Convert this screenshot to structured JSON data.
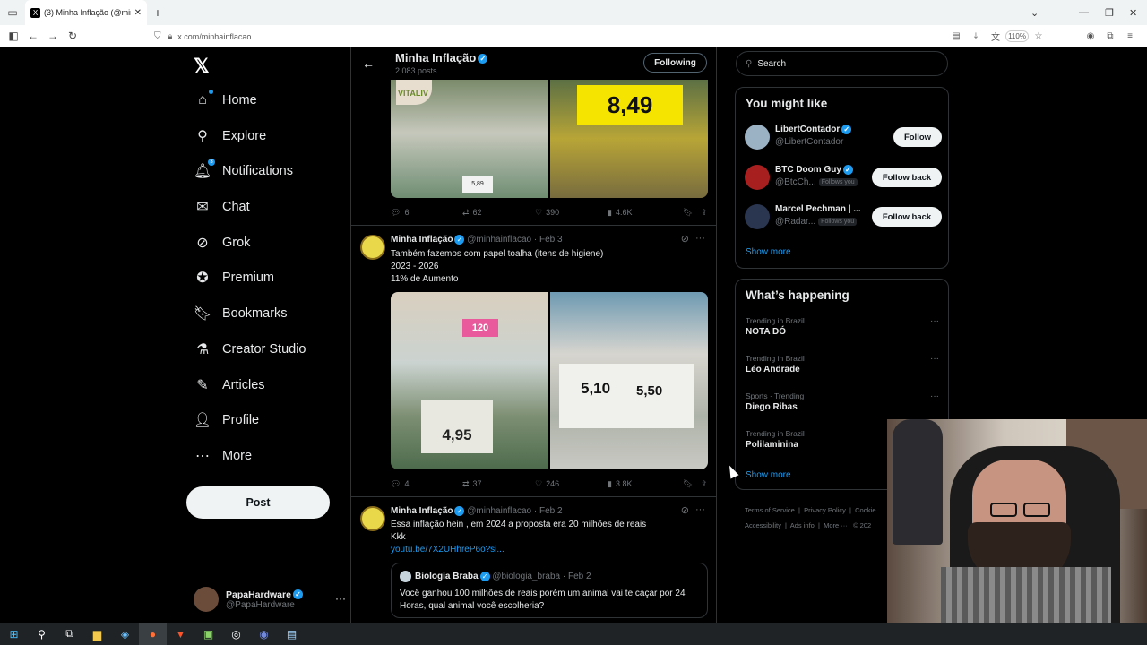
{
  "browser": {
    "tab_title": "(3) Minha Inflação (@minhainfl...",
    "tab_close": "✕",
    "new_tab": "+",
    "url": "x.com/minhainflacao",
    "zoom": "110%"
  },
  "nav": {
    "logo": "𝕏",
    "items": [
      {
        "label": "Home",
        "icon": "home-icon"
      },
      {
        "label": "Explore",
        "icon": "search-icon"
      },
      {
        "label": "Notifications",
        "icon": "bell-icon",
        "badge": "3"
      },
      {
        "label": "Chat",
        "icon": "mail-icon"
      },
      {
        "label": "Grok",
        "icon": "grok-icon"
      },
      {
        "label": "Premium",
        "icon": "premium-icon"
      },
      {
        "label": "Bookmarks",
        "icon": "bookmark-icon"
      },
      {
        "label": "Creator Studio",
        "icon": "flask-icon"
      },
      {
        "label": "Articles",
        "icon": "articles-icon"
      },
      {
        "label": "Profile",
        "icon": "profile-icon"
      },
      {
        "label": "More",
        "icon": "more-circle-icon"
      }
    ],
    "post_label": "Post",
    "account": {
      "name": "PapaHardware",
      "handle": "@PapaHardware"
    }
  },
  "profile_header": {
    "name": "Minha Inflação",
    "posts": "2,083 posts",
    "following_label": "Following"
  },
  "tweets": [
    {
      "stats": {
        "replies": "6",
        "reposts": "62",
        "likes": "390",
        "views": "4.6K"
      },
      "image_labels": [
        "5,89",
        "8,49",
        "VITALIV"
      ]
    },
    {
      "author": "Minha Inflação",
      "handle": "@minhainflacao",
      "date": "Feb 3",
      "lines": [
        "Também fazemos com papel toalha (itens de higiene)",
        "2023 - 2026",
        "11% de Aumento"
      ],
      "image_labels": [
        "120",
        "4,95",
        "5,10",
        "5,50"
      ],
      "stats": {
        "replies": "4",
        "reposts": "37",
        "likes": "246",
        "views": "3.8K"
      }
    },
    {
      "author": "Minha Inflação",
      "handle": "@minhainflacao",
      "date": "Feb 2",
      "lines": [
        "Essa inflação hein , em 2024 a proposta era 20 milhões de reais",
        "Kkk"
      ],
      "link": "youtu.be/7X2UHhreP6o?si...",
      "quote": {
        "author": "Biologia Braba",
        "handle": "@biologia_braba",
        "date": "Feb 2",
        "text_lines": [
          "Você ganhou 100 milhões de reais porém um animal vai te caçar por 24",
          "Horas, qual animal você escolheria?"
        ]
      }
    }
  ],
  "sidebar": {
    "search_placeholder": "Search",
    "you_might_like": {
      "title": "You might like",
      "users": [
        {
          "name": "LibertContador",
          "handle": "@LibertContador",
          "button": "Follow",
          "follows_you": ""
        },
        {
          "name": "BTC Doom Guy",
          "handle": "@BtcCh...",
          "button": "Follow back",
          "follows_you": "Follows you"
        },
        {
          "name": "Marcel Pechman | ...",
          "handle": "@Radar...",
          "button": "Follow back",
          "follows_you": "Follows you"
        }
      ],
      "show_more": "Show more"
    },
    "whats_happening": {
      "title": "What’s happening",
      "trends": [
        {
          "context": "Trending in Brazil",
          "title": "NOTA DÓ"
        },
        {
          "context": "Trending in Brazil",
          "title": "Léo Andrade"
        },
        {
          "context": "Sports · Trending",
          "title": "Diego Ribas"
        },
        {
          "context": "Trending in Brazil",
          "title": "Polilaminina"
        }
      ],
      "show_more": "Show more"
    },
    "footer": {
      "line1": [
        "Terms of Service",
        "Privacy Policy",
        "Cookie"
      ],
      "line2": [
        "Accessibility",
        "Ads info",
        "More ···",
        "© 202"
      ]
    }
  },
  "colors": {
    "accent": "#1d9bf0",
    "bg": "#000000",
    "border": "#2f3336",
    "muted": "#71767b"
  }
}
